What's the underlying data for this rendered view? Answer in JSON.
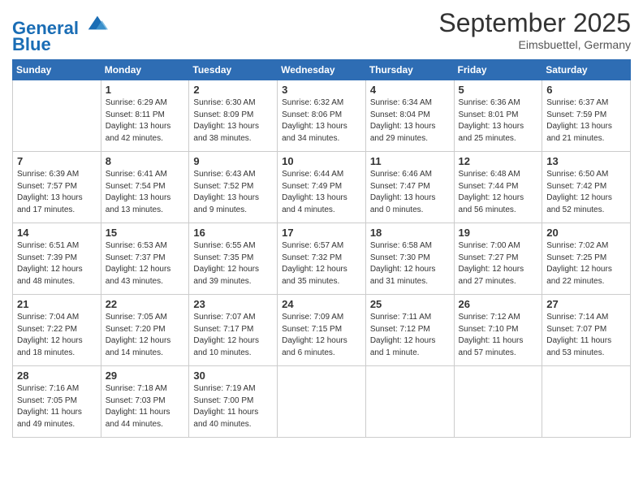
{
  "logo": {
    "line1": "General",
    "line2": "Blue"
  },
  "title": "September 2025",
  "location": "Eimsbuettel, Germany",
  "days_of_week": [
    "Sunday",
    "Monday",
    "Tuesday",
    "Wednesday",
    "Thursday",
    "Friday",
    "Saturday"
  ],
  "weeks": [
    [
      {
        "day": "",
        "content": ""
      },
      {
        "day": "1",
        "content": "Sunrise: 6:29 AM\nSunset: 8:11 PM\nDaylight: 13 hours\nand 42 minutes."
      },
      {
        "day": "2",
        "content": "Sunrise: 6:30 AM\nSunset: 8:09 PM\nDaylight: 13 hours\nand 38 minutes."
      },
      {
        "day": "3",
        "content": "Sunrise: 6:32 AM\nSunset: 8:06 PM\nDaylight: 13 hours\nand 34 minutes."
      },
      {
        "day": "4",
        "content": "Sunrise: 6:34 AM\nSunset: 8:04 PM\nDaylight: 13 hours\nand 29 minutes."
      },
      {
        "day": "5",
        "content": "Sunrise: 6:36 AM\nSunset: 8:01 PM\nDaylight: 13 hours\nand 25 minutes."
      },
      {
        "day": "6",
        "content": "Sunrise: 6:37 AM\nSunset: 7:59 PM\nDaylight: 13 hours\nand 21 minutes."
      }
    ],
    [
      {
        "day": "7",
        "content": "Sunrise: 6:39 AM\nSunset: 7:57 PM\nDaylight: 13 hours\nand 17 minutes."
      },
      {
        "day": "8",
        "content": "Sunrise: 6:41 AM\nSunset: 7:54 PM\nDaylight: 13 hours\nand 13 minutes."
      },
      {
        "day": "9",
        "content": "Sunrise: 6:43 AM\nSunset: 7:52 PM\nDaylight: 13 hours\nand 9 minutes."
      },
      {
        "day": "10",
        "content": "Sunrise: 6:44 AM\nSunset: 7:49 PM\nDaylight: 13 hours\nand 4 minutes."
      },
      {
        "day": "11",
        "content": "Sunrise: 6:46 AM\nSunset: 7:47 PM\nDaylight: 13 hours\nand 0 minutes."
      },
      {
        "day": "12",
        "content": "Sunrise: 6:48 AM\nSunset: 7:44 PM\nDaylight: 12 hours\nand 56 minutes."
      },
      {
        "day": "13",
        "content": "Sunrise: 6:50 AM\nSunset: 7:42 PM\nDaylight: 12 hours\nand 52 minutes."
      }
    ],
    [
      {
        "day": "14",
        "content": "Sunrise: 6:51 AM\nSunset: 7:39 PM\nDaylight: 12 hours\nand 48 minutes."
      },
      {
        "day": "15",
        "content": "Sunrise: 6:53 AM\nSunset: 7:37 PM\nDaylight: 12 hours\nand 43 minutes."
      },
      {
        "day": "16",
        "content": "Sunrise: 6:55 AM\nSunset: 7:35 PM\nDaylight: 12 hours\nand 39 minutes."
      },
      {
        "day": "17",
        "content": "Sunrise: 6:57 AM\nSunset: 7:32 PM\nDaylight: 12 hours\nand 35 minutes."
      },
      {
        "day": "18",
        "content": "Sunrise: 6:58 AM\nSunset: 7:30 PM\nDaylight: 12 hours\nand 31 minutes."
      },
      {
        "day": "19",
        "content": "Sunrise: 7:00 AM\nSunset: 7:27 PM\nDaylight: 12 hours\nand 27 minutes."
      },
      {
        "day": "20",
        "content": "Sunrise: 7:02 AM\nSunset: 7:25 PM\nDaylight: 12 hours\nand 22 minutes."
      }
    ],
    [
      {
        "day": "21",
        "content": "Sunrise: 7:04 AM\nSunset: 7:22 PM\nDaylight: 12 hours\nand 18 minutes."
      },
      {
        "day": "22",
        "content": "Sunrise: 7:05 AM\nSunset: 7:20 PM\nDaylight: 12 hours\nand 14 minutes."
      },
      {
        "day": "23",
        "content": "Sunrise: 7:07 AM\nSunset: 7:17 PM\nDaylight: 12 hours\nand 10 minutes."
      },
      {
        "day": "24",
        "content": "Sunrise: 7:09 AM\nSunset: 7:15 PM\nDaylight: 12 hours\nand 6 minutes."
      },
      {
        "day": "25",
        "content": "Sunrise: 7:11 AM\nSunset: 7:12 PM\nDaylight: 12 hours\nand 1 minute."
      },
      {
        "day": "26",
        "content": "Sunrise: 7:12 AM\nSunset: 7:10 PM\nDaylight: 11 hours\nand 57 minutes."
      },
      {
        "day": "27",
        "content": "Sunrise: 7:14 AM\nSunset: 7:07 PM\nDaylight: 11 hours\nand 53 minutes."
      }
    ],
    [
      {
        "day": "28",
        "content": "Sunrise: 7:16 AM\nSunset: 7:05 PM\nDaylight: 11 hours\nand 49 minutes."
      },
      {
        "day": "29",
        "content": "Sunrise: 7:18 AM\nSunset: 7:03 PM\nDaylight: 11 hours\nand 44 minutes."
      },
      {
        "day": "30",
        "content": "Sunrise: 7:19 AM\nSunset: 7:00 PM\nDaylight: 11 hours\nand 40 minutes."
      },
      {
        "day": "",
        "content": ""
      },
      {
        "day": "",
        "content": ""
      },
      {
        "day": "",
        "content": ""
      },
      {
        "day": "",
        "content": ""
      }
    ]
  ]
}
